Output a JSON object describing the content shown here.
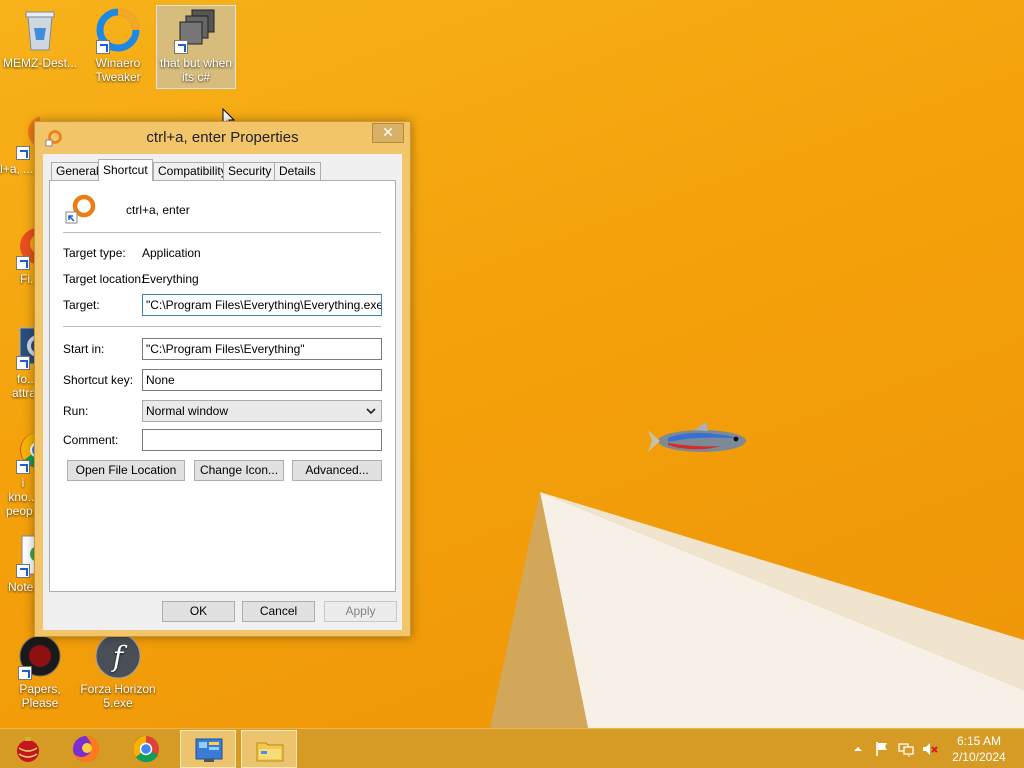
{
  "desktop": {
    "icons": [
      {
        "label": "MEMZ-Dest..."
      },
      {
        "label": "Winaero Tweaker"
      },
      {
        "label": "that but when its c#"
      },
      {
        "label": "ctrl+a, ..."
      },
      {
        "label": "Fi..."
      },
      {
        "label": "fo... attra..."
      },
      {
        "label": "i kno... peop..."
      },
      {
        "label": "Note..."
      },
      {
        "label": "Papers, Please"
      },
      {
        "label": "Forza Horizon 5.exe"
      }
    ]
  },
  "dialog": {
    "title": "ctrl+a, enter Properties",
    "close_glyph": "✕",
    "tabs": [
      {
        "label": "General"
      },
      {
        "label": "Shortcut"
      },
      {
        "label": "Compatibility"
      },
      {
        "label": "Security"
      },
      {
        "label": "Details"
      }
    ],
    "active_tab": "Shortcut",
    "shortcut_name": "ctrl+a, enter",
    "target_type": {
      "label": "Target type:",
      "value": "Application"
    },
    "target_location": {
      "label": "Target location:",
      "value": "Everything"
    },
    "target": {
      "label": "Target:",
      "value": "\"C:\\Program Files\\Everything\\Everything.exe\""
    },
    "start_in": {
      "label": "Start in:",
      "value": "\"C:\\Program Files\\Everything\""
    },
    "shortcut_key": {
      "label": "Shortcut key:",
      "value": "None"
    },
    "run": {
      "label": "Run:",
      "value": "Normal window"
    },
    "comment": {
      "label": "Comment:",
      "value": ""
    },
    "buttons": {
      "open_file_location": "Open File Location",
      "change_icon": "Change Icon...",
      "advanced": "Advanced...",
      "ok": "OK",
      "cancel": "Cancel",
      "apply": "Apply"
    }
  },
  "taskbar": {
    "clock_time": "6:15 AM",
    "clock_date": "2/10/2024"
  },
  "colors": {
    "desktop_orange": "#f4a10b",
    "dialog_frame": "#f3c56a",
    "taskbar": "#d59b24",
    "focus_border": "#3c7fb1"
  }
}
